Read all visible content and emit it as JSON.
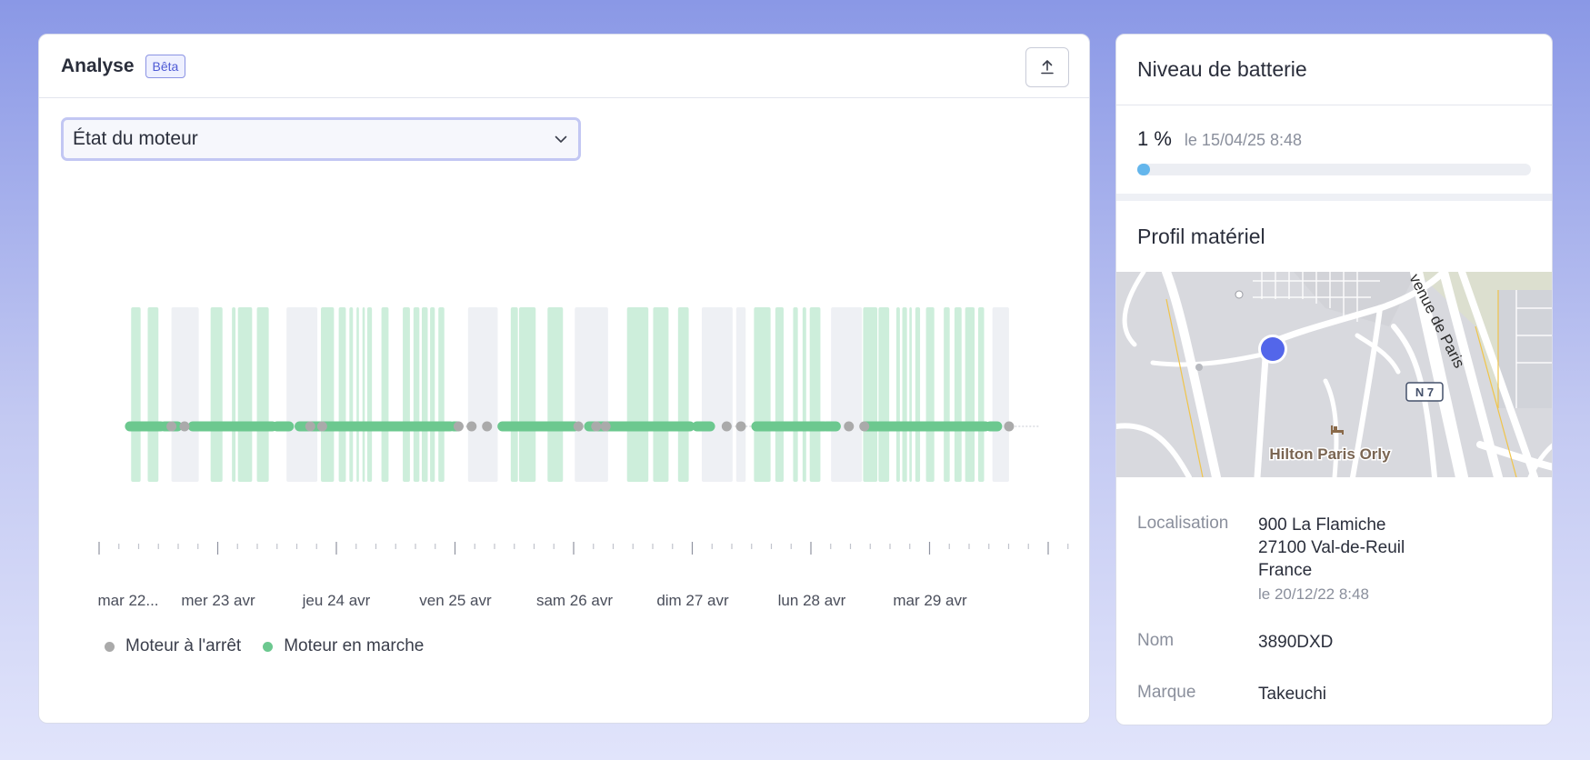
{
  "analysis": {
    "title": "Analyse",
    "badge": "Bêta",
    "export_icon": "upload-icon",
    "metric_select": {
      "value": "État du moteur",
      "icon": "chevron-down-icon"
    }
  },
  "chart_data": {
    "type": "timeline",
    "x_ticks": [
      "mar 22...",
      "mer 23 avr",
      "jeu 24 avr",
      "ven 25 avr",
      "sam 26 avr",
      "dim 27 avr",
      "lun 28 avr",
      "mar 29 avr"
    ],
    "legend": [
      {
        "label": "Moteur à l'arrêt",
        "color": "#aaaaaa"
      },
      {
        "label": "Moteur en marche",
        "color": "#6cc88f"
      }
    ],
    "running_color": "#6cc88f",
    "stopped_color": "#aaaaaa",
    "running_band_color": "#cdeedb",
    "stopped_band_color": "#eef0f4",
    "x_range_days": [
      -0.25,
      7.55
    ],
    "bands": [
      {
        "s": -0.07,
        "e": 0.01,
        "st": "run"
      },
      {
        "s": 0.07,
        "e": 0.16,
        "st": "run"
      },
      {
        "s": 0.27,
        "e": 0.5,
        "st": "stop"
      },
      {
        "s": 0.6,
        "e": 0.7,
        "st": "run"
      },
      {
        "s": 0.78,
        "e": 0.81,
        "st": "run"
      },
      {
        "s": 0.83,
        "e": 0.95,
        "st": "run"
      },
      {
        "s": 0.99,
        "e": 1.09,
        "st": "run"
      },
      {
        "s": 1.24,
        "e": 1.5,
        "st": "stop"
      },
      {
        "s": 1.53,
        "e": 1.64,
        "st": "run"
      },
      {
        "s": 1.68,
        "e": 1.74,
        "st": "run"
      },
      {
        "s": 1.77,
        "e": 1.8,
        "st": "run"
      },
      {
        "s": 1.83,
        "e": 1.85,
        "st": "run"
      },
      {
        "s": 1.88,
        "e": 1.9,
        "st": "run"
      },
      {
        "s": 1.92,
        "e": 1.96,
        "st": "run"
      },
      {
        "s": 2.04,
        "e": 2.1,
        "st": "run"
      },
      {
        "s": 2.22,
        "e": 2.28,
        "st": "run"
      },
      {
        "s": 2.31,
        "e": 2.36,
        "st": "run"
      },
      {
        "s": 2.38,
        "e": 2.43,
        "st": "run"
      },
      {
        "s": 2.45,
        "e": 2.49,
        "st": "run"
      },
      {
        "s": 2.52,
        "e": 2.57,
        "st": "run"
      },
      {
        "s": 2.77,
        "e": 3.02,
        "st": "stop"
      },
      {
        "s": 3.13,
        "e": 3.19,
        "st": "run"
      },
      {
        "s": 3.2,
        "e": 3.34,
        "st": "run"
      },
      {
        "s": 3.44,
        "e": 3.57,
        "st": "run"
      },
      {
        "s": 3.67,
        "e": 3.95,
        "st": "stop"
      },
      {
        "s": 4.11,
        "e": 4.29,
        "st": "run"
      },
      {
        "s": 4.33,
        "e": 4.46,
        "st": "run"
      },
      {
        "s": 4.54,
        "e": 4.63,
        "st": "run"
      },
      {
        "s": 4.74,
        "e": 5.0,
        "st": "stop"
      },
      {
        "s": 5.03,
        "e": 5.11,
        "st": "stop"
      },
      {
        "s": 5.18,
        "e": 5.32,
        "st": "run"
      },
      {
        "s": 5.36,
        "e": 5.43,
        "st": "run"
      },
      {
        "s": 5.51,
        "e": 5.55,
        "st": "run"
      },
      {
        "s": 5.59,
        "e": 5.62,
        "st": "run"
      },
      {
        "s": 5.65,
        "e": 5.74,
        "st": "run"
      },
      {
        "s": 5.83,
        "e": 6.09,
        "st": "stop"
      },
      {
        "s": 6.1,
        "e": 6.22,
        "st": "run"
      },
      {
        "s": 6.23,
        "e": 6.32,
        "st": "run"
      },
      {
        "s": 6.38,
        "e": 6.41,
        "st": "run"
      },
      {
        "s": 6.43,
        "e": 6.47,
        "st": "run"
      },
      {
        "s": 6.49,
        "e": 6.51,
        "st": "run"
      },
      {
        "s": 6.54,
        "e": 6.58,
        "st": "run"
      },
      {
        "s": 6.63,
        "e": 6.7,
        "st": "run"
      },
      {
        "s": 6.78,
        "e": 6.83,
        "st": "run"
      },
      {
        "s": 6.87,
        "e": 6.93,
        "st": "run"
      },
      {
        "s": 6.96,
        "e": 7.04,
        "st": "run"
      },
      {
        "s": 7.07,
        "e": 7.12,
        "st": "run"
      },
      {
        "s": 7.19,
        "e": 7.33,
        "st": "stop"
      }
    ],
    "run_segments": [
      [
        -0.08,
        0.18
      ],
      [
        0.21,
        0.32
      ],
      [
        0.45,
        1.12
      ],
      [
        1.16,
        1.26
      ],
      [
        1.35,
        2.62
      ],
      [
        2.65,
        2.68
      ],
      [
        3.06,
        3.67
      ],
      [
        3.79,
        4.64
      ],
      [
        4.7,
        4.81
      ],
      [
        5.2,
        5.77
      ],
      [
        5.79,
        5.87
      ],
      [
        6.12,
        7.13
      ],
      [
        7.17,
        7.23
      ]
    ],
    "stop_points": [
      0.27,
      0.38,
      1.44,
      1.54,
      2.69,
      2.8,
      2.93,
      3.7,
      3.85,
      3.93,
      4.95,
      5.07,
      5.98,
      6.11,
      7.33
    ]
  },
  "battery": {
    "title": "Niveau de batterie",
    "value": "1 %",
    "date": "le 15/04/25 8:48",
    "level_fraction": 0.01,
    "bar_color": "#64b6ec"
  },
  "profile": {
    "title": "Profil matériel",
    "map": {
      "poi_label": "Hilton Paris Orly",
      "road_label": "venue de Paris",
      "shield_label": "N 7",
      "pin_icon": "location-pin-icon",
      "hotel_icon": "bed-icon"
    },
    "location_label": "Localisation",
    "location_lines": [
      "900 La Flamiche",
      "27100 Val-de-Reuil",
      "France"
    ],
    "location_date": "le 20/12/22 8:48",
    "name_label": "Nom",
    "name_value": "3890DXD",
    "brand_label": "Marque",
    "brand_value": "Takeuchi"
  }
}
